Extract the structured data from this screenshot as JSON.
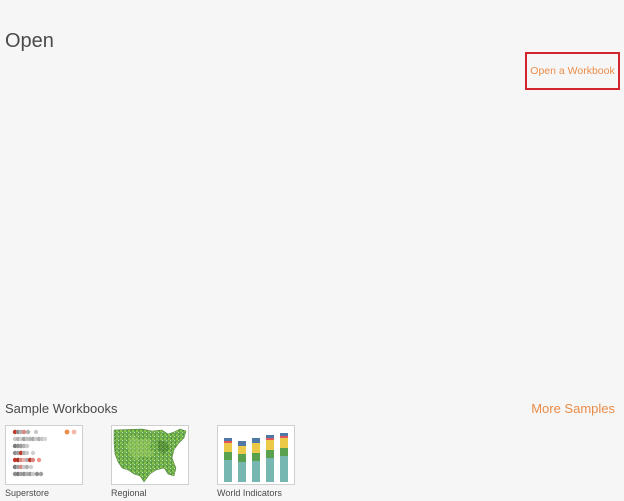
{
  "header": {
    "title": "Open",
    "open_workbook_label": "Open a Workbook"
  },
  "samples": {
    "title": "Sample Workbooks",
    "more_label": "More Samples",
    "items": [
      {
        "label": "Superstore",
        "icon": "superstore-thumbnail"
      },
      {
        "label": "Regional",
        "icon": "us-map-thumbnail"
      },
      {
        "label": "World Indicators",
        "icon": "stacked-bar-thumbnail"
      }
    ]
  },
  "colors": {
    "accent": "#eb8c47",
    "highlight_border": "#d3242d",
    "background": "#f6f6f6",
    "text": "#4a4a4a"
  }
}
